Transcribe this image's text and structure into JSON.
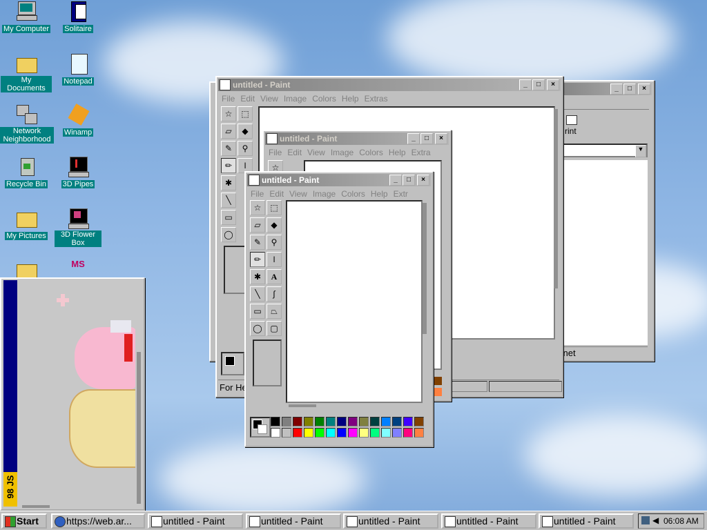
{
  "desktop": {
    "icons": [
      {
        "label": "My Computer"
      },
      {
        "label": "Solitaire"
      },
      {
        "label": "My Documents"
      },
      {
        "label": "Notepad"
      },
      {
        "label": "Network Neighborhood"
      },
      {
        "label": "Winamp"
      },
      {
        "label": "Recycle Bin"
      },
      {
        "label": "3D Pipes"
      },
      {
        "label": "My Pictures"
      },
      {
        "label": "3D Flower Box"
      },
      {
        "label": ""
      },
      {
        "label": "MS"
      }
    ]
  },
  "back_window": {
    "title": "untitled - Paint",
    "menu": [
      "File",
      "Edit",
      "View",
      "Image",
      "Colors",
      "Help",
      "Extras"
    ],
    "status": "For He"
  },
  "ie_window": {
    "print_label": "rint",
    "status": "ernet"
  },
  "mid_window": {
    "title": "untitled - Paint",
    "menu": [
      "File",
      "Edit",
      "View",
      "Image",
      "Colors",
      "Help",
      "Extra"
    ]
  },
  "front_window": {
    "title": "untitled - Paint",
    "menu": [
      "File",
      "Edit",
      "View",
      "Image",
      "Colors",
      "Help",
      "Extr"
    ]
  },
  "side_panel": {
    "vertical_text": "98 JS"
  },
  "palette": {
    "top": [
      "#000000",
      "#808080",
      "#800000",
      "#808000",
      "#008000",
      "#008080",
      "#000080",
      "#800080",
      "#808040",
      "#004040",
      "#0080ff",
      "#004080",
      "#4000ff",
      "#804000"
    ],
    "bottom": [
      "#ffffff",
      "#c0c0c0",
      "#ff0000",
      "#ffff00",
      "#00ff00",
      "#00ffff",
      "#0000ff",
      "#ff00ff",
      "#ffff80",
      "#00ff80",
      "#80ffff",
      "#8080ff",
      "#ff0080",
      "#ff8040"
    ]
  },
  "taskbar": {
    "start": "Start",
    "buttons": [
      "https://web.ar...",
      "untitled - Paint",
      "untitled - Paint",
      "untitled - Paint",
      "untitled - Paint",
      "untitled - Paint"
    ],
    "clock": "06:08 AM"
  }
}
